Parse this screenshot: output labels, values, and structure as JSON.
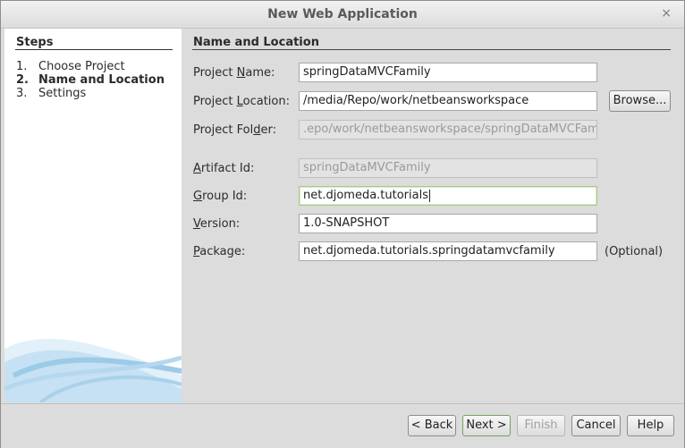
{
  "window": {
    "title": "New Web Application",
    "close_glyph": "×"
  },
  "steps": {
    "heading": "Steps",
    "items": [
      {
        "num": "1.",
        "label": "Choose Project"
      },
      {
        "num": "2.",
        "label": "Name and Location"
      },
      {
        "num": "3.",
        "label": "Settings"
      }
    ]
  },
  "section": {
    "title": "Name and Location"
  },
  "fields": {
    "project_name": {
      "pre": "Project ",
      "mnemonic": "N",
      "post": "ame:",
      "value": "springDataMVCFamily"
    },
    "project_location": {
      "pre": "Project ",
      "mnemonic": "L",
      "post": "ocation:",
      "value": "/media/Repo/work/netbeansworkspace"
    },
    "project_folder": {
      "pre": "Project Fol",
      "mnemonic": "d",
      "post": "er:",
      "value": ".epo/work/netbeansworkspace/springDataMVCFamily"
    },
    "artifact_id": {
      "pre": "",
      "mnemonic": "A",
      "post": "rtifact Id:",
      "value": "springDataMVCFamily"
    },
    "group_id": {
      "pre": "",
      "mnemonic": "G",
      "post": "roup Id:",
      "value": "net.djomeda.tutorials"
    },
    "version": {
      "pre": "",
      "mnemonic": "V",
      "post": "ersion:",
      "value": "1.0-SNAPSHOT"
    },
    "package": {
      "pre": "",
      "mnemonic": "P",
      "post": "ackage:",
      "value": "net.djomeda.tutorials.springdatamvcfamily",
      "hint": "(Optional)"
    }
  },
  "buttons": {
    "browse": "Browse...",
    "back": "< Back",
    "next": "Next >",
    "finish": "Finish",
    "cancel": "Cancel",
    "help": "Help"
  },
  "colors": {
    "steps_bg": "#ffffff",
    "panel_bg": "#dcdcdc",
    "wave_accent": "#8fc3e3",
    "focus_border": "#a9c98a"
  }
}
